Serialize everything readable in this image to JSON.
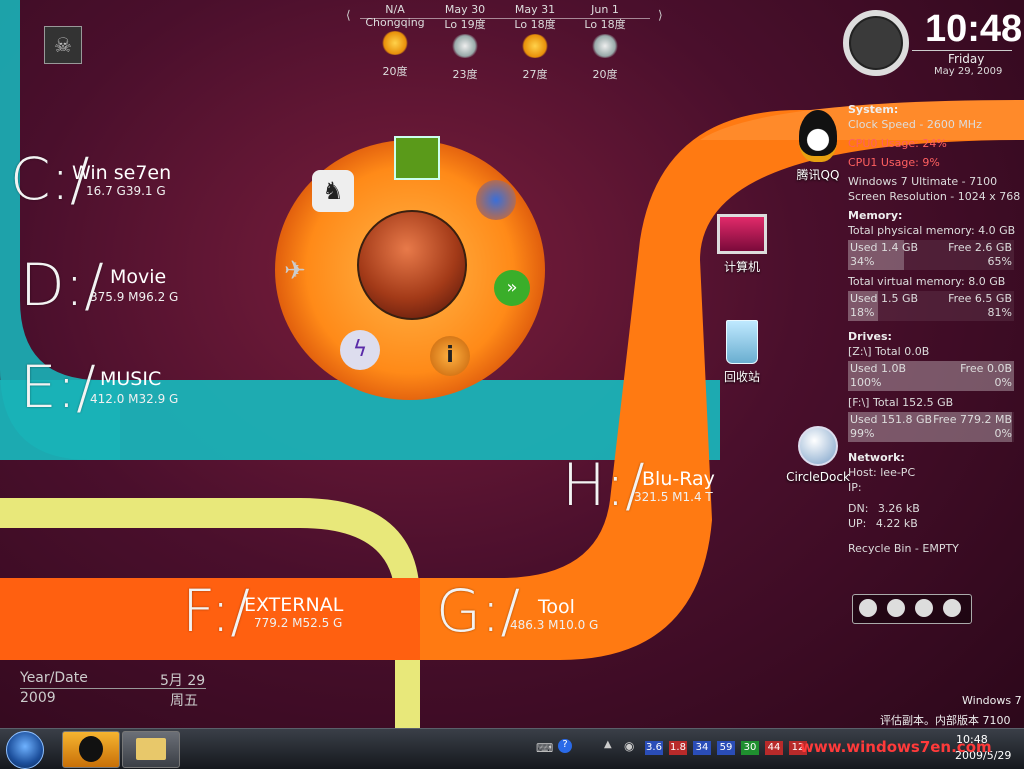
{
  "weather": {
    "days": [
      {
        "date": "N/A",
        "desc": "Chongqing",
        "temp": "20度",
        "icon": "sun-icon"
      },
      {
        "date": "May 30",
        "desc": "Lo 19度",
        "temp": "23度",
        "icon": "storm-icon"
      },
      {
        "date": "May 31",
        "desc": "Lo 18度",
        "temp": "27度",
        "icon": "sun-icon"
      },
      {
        "date": "Jun 1",
        "desc": "Lo 18度",
        "temp": "20度",
        "icon": "storm-icon"
      }
    ]
  },
  "clock": {
    "time": "10:48",
    "day": "Friday",
    "date": "May 29, 2009"
  },
  "drives": [
    {
      "letter": "C:/",
      "name": "Win se7en",
      "size": "16.7 G39.1 G"
    },
    {
      "letter": "D:/",
      "name": "Movie",
      "size": "375.9 M96.2 G"
    },
    {
      "letter": "E:/",
      "name": "MUSIC",
      "size": "412.0 M32.9 G"
    },
    {
      "letter": "H:/",
      "name": "Blu-Ray",
      "size": "321.5 M1.4 T"
    },
    {
      "letter": "F:/",
      "name": "EXTERNAL",
      "size": "779.2 M52.5 G"
    },
    {
      "letter": "G:/",
      "name": "Tool",
      "size": "486.3 M10.0 G"
    }
  ],
  "system": {
    "header": "System:",
    "clock_speed": "Clock Speed - 2600 MHz",
    "cpu0": "CPU0 Usage: 24%",
    "cpu1": "CPU1 Usage: 9%",
    "os": "Windows 7 Ultimate  - 7100",
    "resolution": "Screen Resolution - 1024 x 768",
    "memory_header": "Memory:",
    "physical_total": "Total physical memory: 4.0 GB",
    "physical": {
      "used": "Used 1.4 GB",
      "free": "Free 2.6 GB",
      "used_pct": "34%",
      "free_pct": "65%",
      "fraction": 0.34
    },
    "virtual_total": "Total virtual memory: 8.0 GB",
    "virtual": {
      "used": "Used 1.5 GB",
      "free": "Free 6.5 GB",
      "used_pct": "18%",
      "free_pct": "81%",
      "fraction": 0.18
    },
    "drives_header": "Drives:",
    "z_total": "[Z:\\] Total 0.0B",
    "z": {
      "used": "Used 1.0B",
      "free": "Free 0.0B",
      "used_pct": "100%",
      "free_pct": "0%",
      "fraction": 1.0
    },
    "f_total": "[F:\\] Total 152.5 GB",
    "f": {
      "used": "Used 151.8 GB",
      "free": "Free 779.2 MB",
      "used_pct": "99%",
      "free_pct": "0%",
      "fraction": 0.99
    },
    "network_header": "Network:",
    "host": "Host: lee-PC",
    "ip": "IP:",
    "dn_label": "DN:",
    "dn": "3.26 kB",
    "up_label": "UP:",
    "up": "4.22 kB",
    "recycle": "Recycle Bin - EMPTY"
  },
  "desktop_icons": [
    {
      "label": "腾讯QQ",
      "icon": "qq-penguin-icon"
    },
    {
      "label": "计算机",
      "icon": "computer-icon"
    },
    {
      "label": "回收站",
      "icon": "recycle-bin-icon"
    },
    {
      "label": "CircleDock",
      "icon": "circledock-icon"
    }
  ],
  "year_date": {
    "label": "Year/Date",
    "md": "5月 29",
    "year": "2009",
    "weekday": "周五"
  },
  "watermark": {
    "line1": "Windows 7",
    "line2": "评估副本。内部版本 7100",
    "site": "www.windows7en.com"
  },
  "taskbar": {
    "time": "10:48",
    "date": "2009/5/29",
    "tray_values": [
      "3.6",
      "1.8",
      "34",
      "59",
      "30",
      "44",
      "12"
    ],
    "tray_colors": [
      "#2a4db8",
      "#b82a2a",
      "#2a4db8",
      "#2a4db8",
      "#1f8f2f",
      "#b82a2a",
      "#b82a2a"
    ]
  }
}
